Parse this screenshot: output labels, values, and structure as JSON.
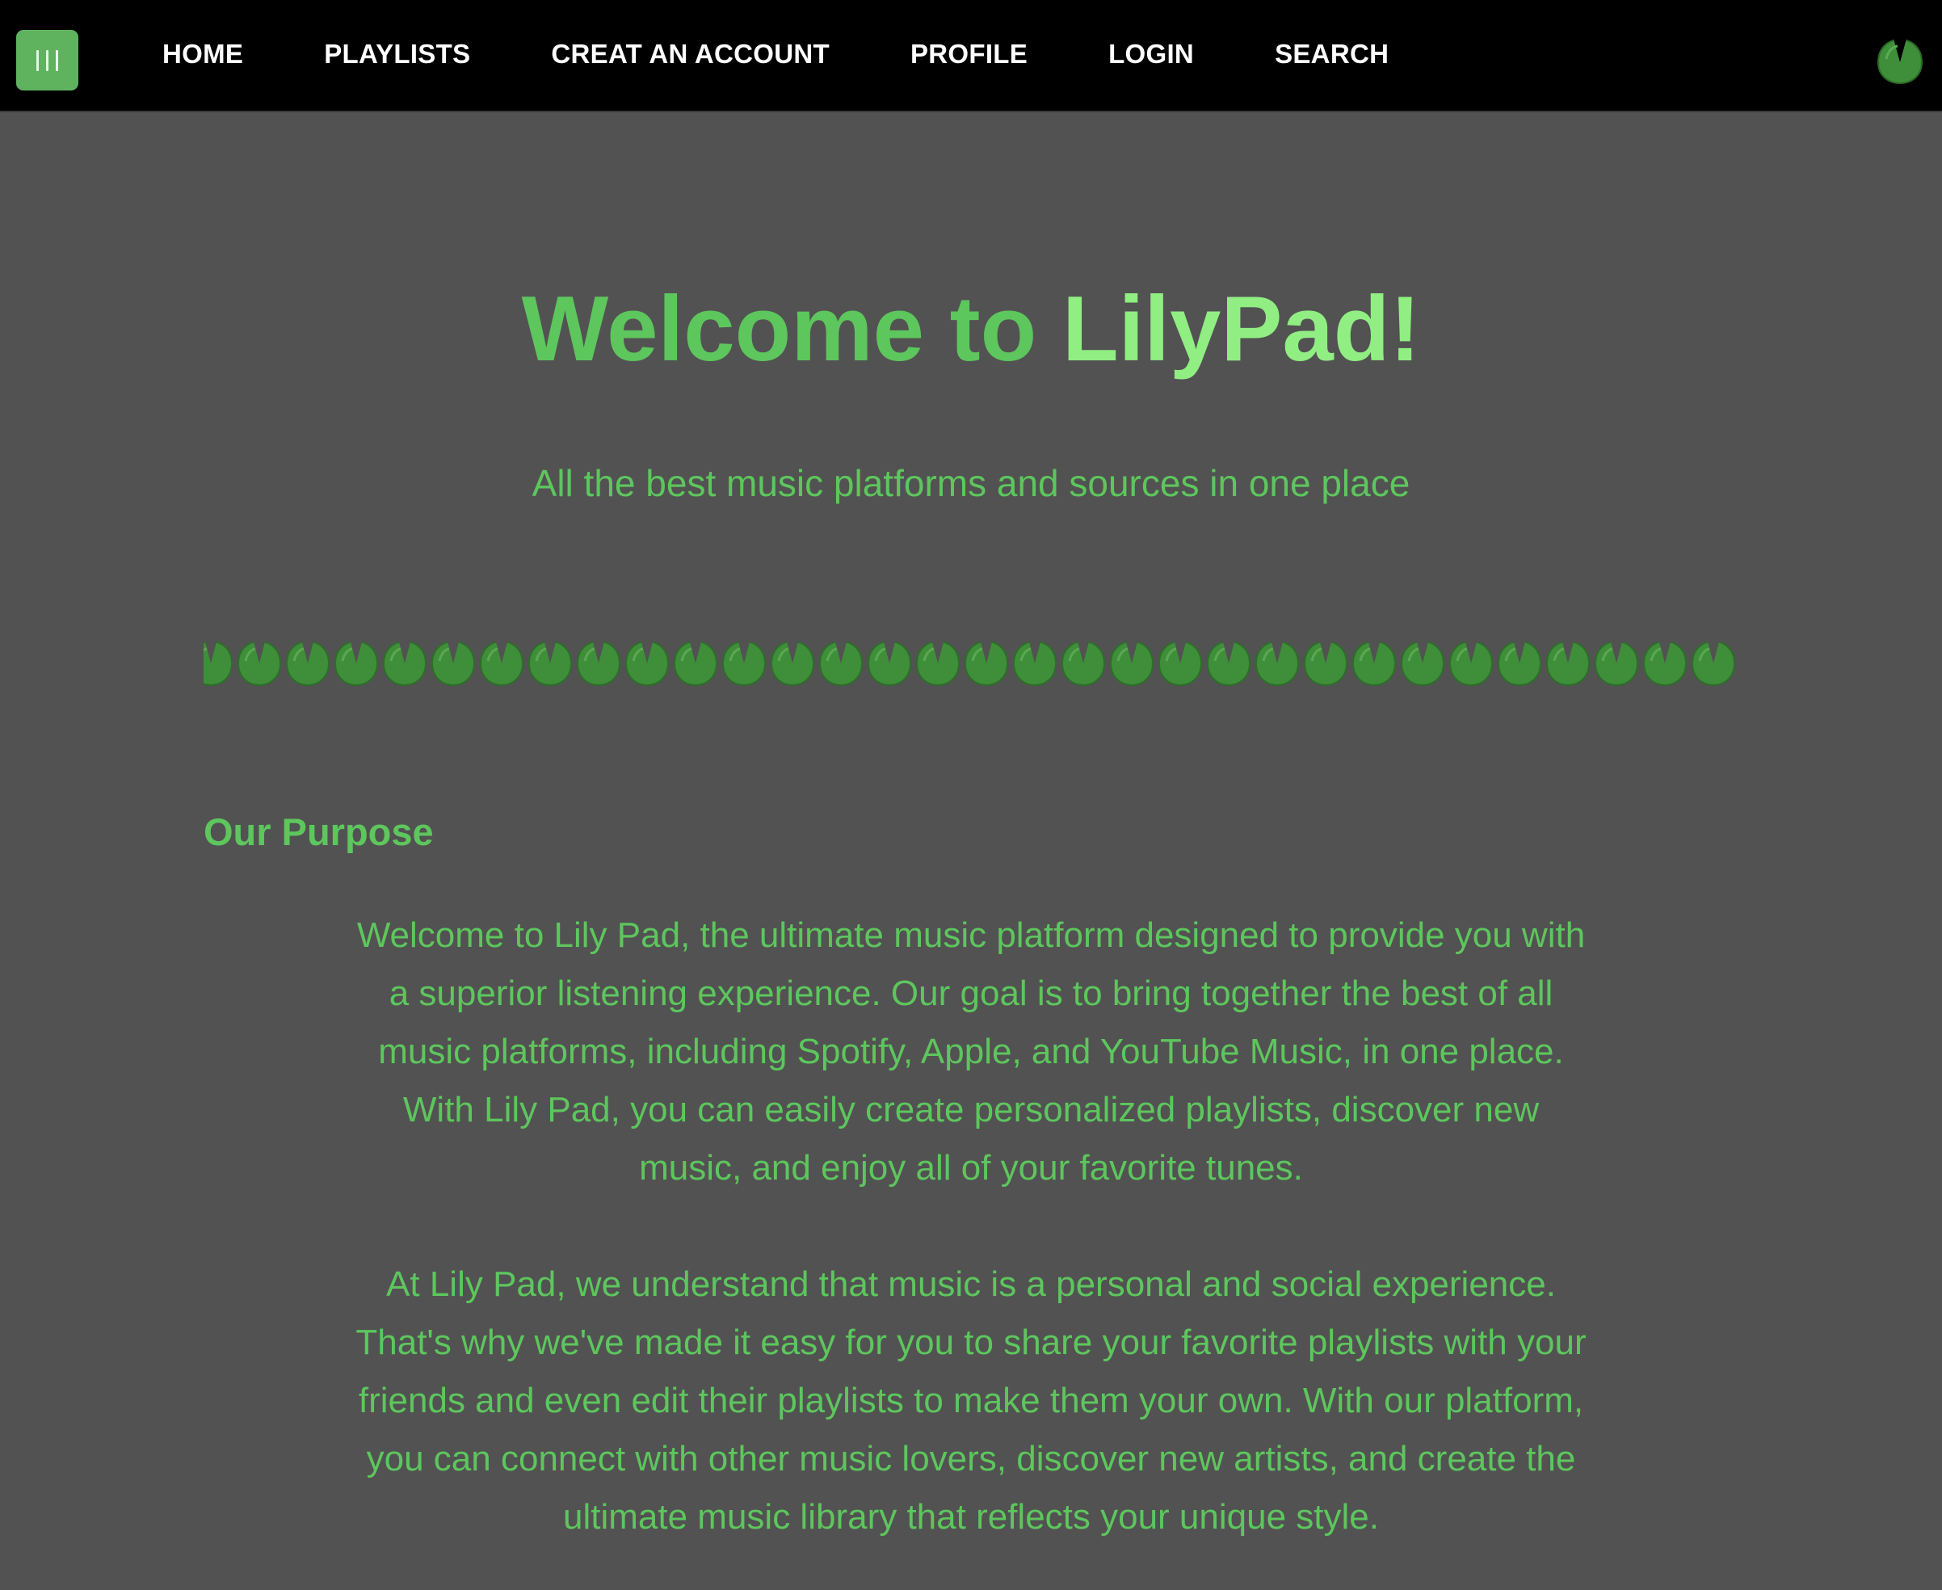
{
  "nav": {
    "menu_icon": "menu-bars-icon",
    "links": [
      "HOME",
      "PLAYLISTS",
      "CREAT AN ACCOUNT",
      "PROFILE",
      "LOGIN",
      "SEARCH"
    ],
    "logo_icon": "lily-pad-icon"
  },
  "hero": {
    "title_prefix": "Welcome to",
    "title_brand": "LilyPad!",
    "subtitle": "All the best music platforms and sources in one place"
  },
  "divider": {
    "icon": "lily-pad-icon",
    "count": 32
  },
  "purpose": {
    "heading": "Our Purpose",
    "paragraphs": [
      "Welcome to Lily Pad, the ultimate music platform designed to provide you with a superior listening experience. Our goal is to bring together the best of all music platforms, including Spotify, Apple, and YouTube Music, in one place. With Lily Pad, you can easily create personalized playlists, discover new music, and enjoy all of your favorite tunes.",
      "At Lily Pad, we understand that music is a personal and social experience. That's why we've made it easy for you to share your favorite playlists with your friends and even edit their playlists to make them your own. With our platform, you can connect with other music lovers, discover new artists, and create the ultimate music library that reflects your unique style."
    ]
  },
  "colors": {
    "page_background": "#525252",
    "navbar_background": "#000000",
    "accent_green": "#5dc65d",
    "brand_light_green": "#90ee82",
    "menu_button_green": "#5fb35f",
    "lily_pad_green": "#3f8f3a"
  }
}
